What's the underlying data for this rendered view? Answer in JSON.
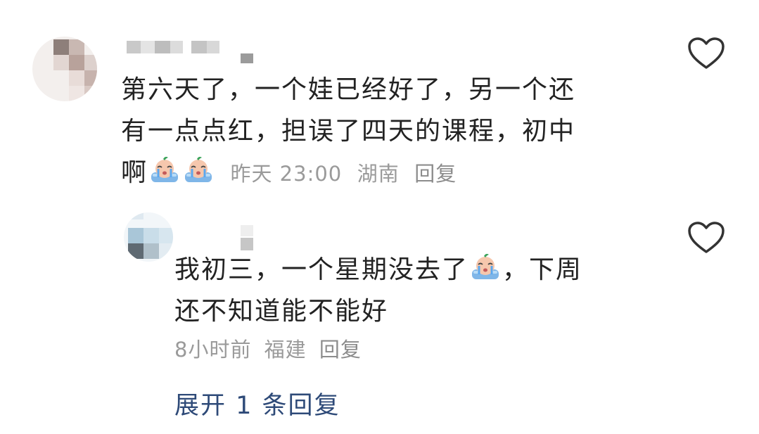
{
  "comment_main": {
    "text_line1": "第六天了，一个娃已经好了，另一个还",
    "text_line2": "有一点点红，担误了四天的课程，初中",
    "text_line3": "啊",
    "emoji_name": "crying-emoji",
    "time": "昨天 23:00",
    "location": "湖南",
    "reply_label": "回复"
  },
  "comment_reply": {
    "text_line1": "我初三，一个星期没去了",
    "text_line1_end": "，下周",
    "text_line2": "还不知道能不能好",
    "emoji_name": "crying-emoji",
    "time": "8小时前",
    "location": "福建",
    "reply_label": "回复"
  },
  "expand_replies_label": "展开 1 条回复",
  "icons": {
    "like": "heart-outline-icon"
  },
  "colors": {
    "text": "#222222",
    "meta": "#9a9a9a",
    "link": "#2e4a78",
    "icon": "#333333"
  }
}
